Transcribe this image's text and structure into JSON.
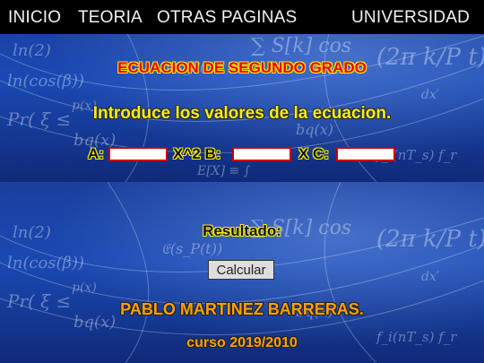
{
  "nav": {
    "items": [
      "INICIO",
      "TEORIA",
      "OTRAS PAGINAS",
      "UNIVERSIDAD"
    ]
  },
  "main": {
    "title": "ECUACION DE SEGUNDO GRADO",
    "intro": "Introduce los valores de la ecuacion.",
    "label_a": "A:",
    "label_b": "X^2 B:",
    "label_c": "X C:",
    "input_a": "",
    "input_b": "",
    "input_c": "",
    "result_label": "Resultado:",
    "calc_button": "Calcular",
    "author": "PABLO MARTINEZ BARRERAS.",
    "course": "curso 2019/2010"
  },
  "colors": {
    "nav_bg": "#000000",
    "title_red": "#e8000a",
    "accent_yellow": "#f6ee12",
    "footer_orange": "#ffa000",
    "background_blue": "#1a49b3"
  }
}
